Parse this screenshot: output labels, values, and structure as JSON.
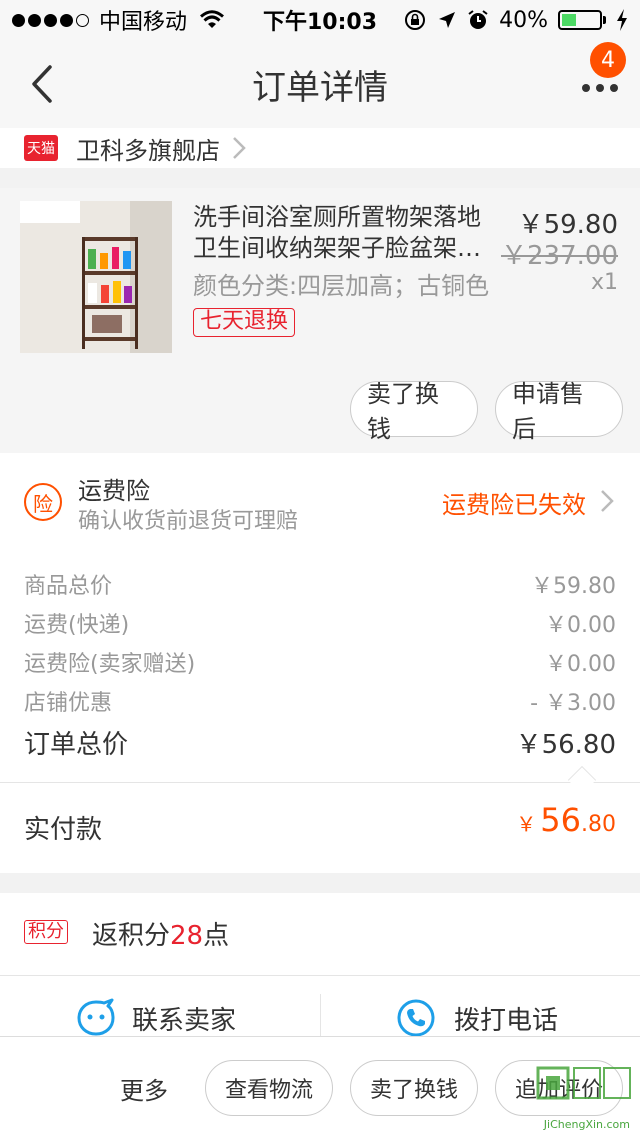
{
  "status_bar": {
    "carrier": "中国移动",
    "time": "下午10:03",
    "battery": "40%",
    "battery_level": 0.4
  },
  "nav": {
    "title": "订单详情",
    "badge_count": "4"
  },
  "shop": {
    "logo_text": "天猫",
    "name": "卫科多旗舰店"
  },
  "product": {
    "title_line1": "洗手间浴室厕所置物架落地",
    "title_line2": "卫生间收纳架架子脸盆架置物架",
    "sku": "颜色分类:四层加高；古铜色",
    "return_tag": "七天退换",
    "price": "￥59.80",
    "original_price": "￥237.00",
    "quantity": "x1",
    "btn_sell": "卖了换钱",
    "btn_after_sale": "申请售后"
  },
  "insurance": {
    "icon_text": "险",
    "title": "运费险",
    "desc": "确认收货前退货可理赔",
    "status": "运费险已失效"
  },
  "summary": {
    "rows": [
      {
        "label": "商品总价",
        "value": "￥59.80"
      },
      {
        "label": "运费(快递)",
        "value": "￥0.00"
      },
      {
        "label": "运费险(卖家赠送)",
        "value": "￥0.00"
      },
      {
        "label": "店铺优惠",
        "value": "- ￥3.00"
      }
    ],
    "total_label": "订单总价",
    "total_value": "￥56.80"
  },
  "paid": {
    "label": "实付款",
    "currency": "￥",
    "int": "56",
    "dec": ".80"
  },
  "points": {
    "tag": "积分",
    "prefix": "返积分",
    "num": "28",
    "suffix": "点"
  },
  "contact": {
    "seller": "联系卖家",
    "phone": "拨打电话"
  },
  "bottom": {
    "more": "更多",
    "btn_logistics": "查看物流",
    "btn_sell": "卖了换钱",
    "btn_review": "追加评价"
  },
  "watermark": {
    "text": "JiChengXin.com"
  },
  "colors": {
    "accent": "#ff5000",
    "tmall_red": "#e8232f",
    "contact_blue": "#1e9fe8"
  }
}
